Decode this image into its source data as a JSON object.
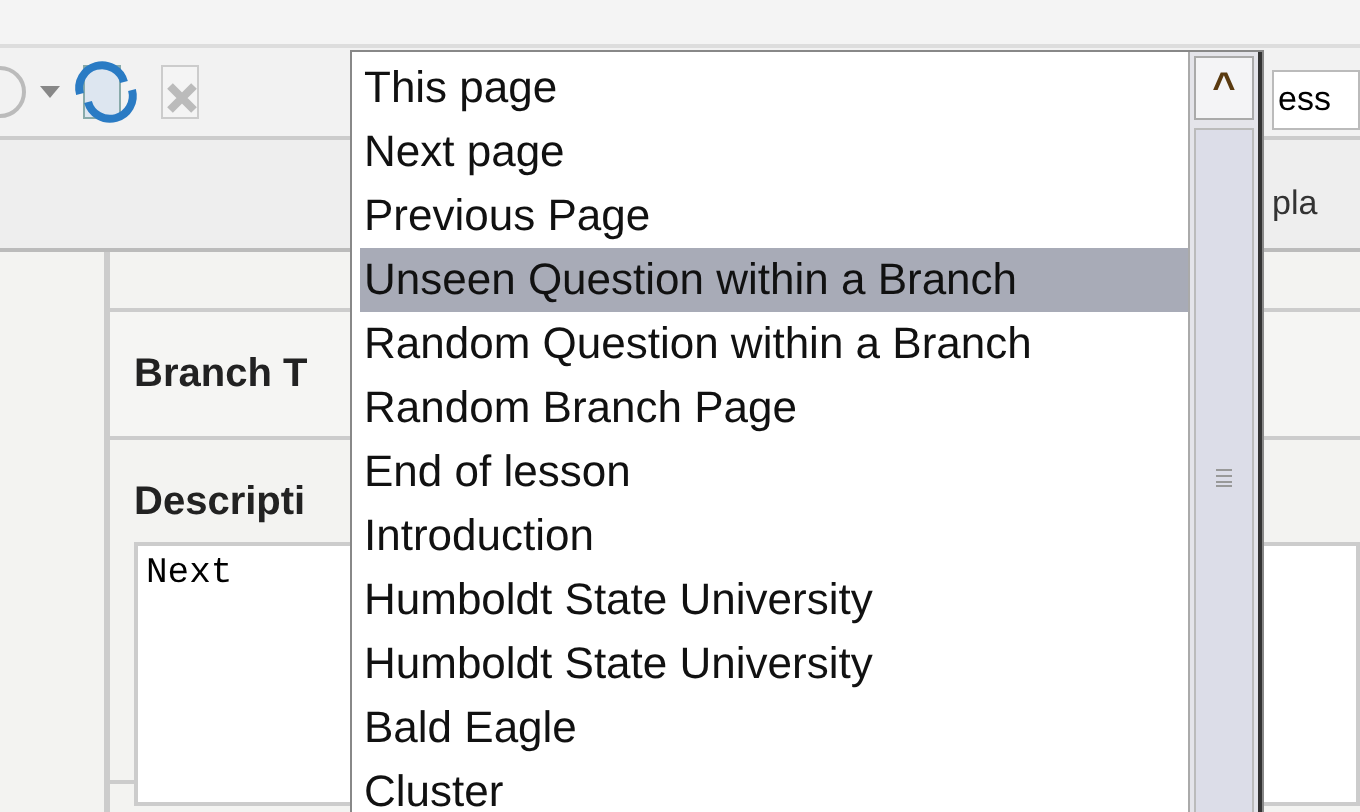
{
  "toolbar": {
    "field_text": "ess"
  },
  "side_text": "pla",
  "form": {
    "branch_label": "Branch T",
    "description_label": "Descripti",
    "description_value": "Next"
  },
  "dropdown": {
    "items": [
      {
        "label": "This page",
        "selected": false
      },
      {
        "label": "Next page",
        "selected": false
      },
      {
        "label": "Previous Page",
        "selected": false
      },
      {
        "label": "Unseen Question within a Branch",
        "selected": true
      },
      {
        "label": "Random Question within a Branch",
        "selected": false
      },
      {
        "label": "Random Branch Page",
        "selected": false
      },
      {
        "label": "End of lesson",
        "selected": false
      },
      {
        "label": "Introduction",
        "selected": false
      },
      {
        "label": "Humboldt State University",
        "selected": false
      },
      {
        "label": "Humboldt State University",
        "selected": false
      },
      {
        "label": "Bald Eagle",
        "selected": false
      },
      {
        "label": "Cluster",
        "selected": false
      }
    ],
    "scroll_arrow": "^"
  }
}
